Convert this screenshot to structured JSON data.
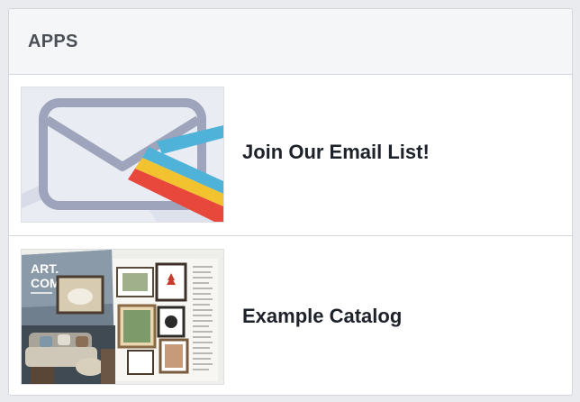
{
  "panel": {
    "title": "APPS"
  },
  "apps": [
    {
      "label": "Join Our Email List!",
      "icon": "envelope-icon"
    },
    {
      "label": "Example Catalog",
      "icon": "catalog-image"
    }
  ],
  "catalog_thumbnail": {
    "brand_line1": "ART.",
    "brand_line2": "COM"
  },
  "colors": {
    "page_background": "#e9ebee",
    "header_background": "#f5f6f7",
    "border": "#d3d6db",
    "envelope_stroke": "#9ea4bb",
    "stripe_blue": "#4fb3d9",
    "stripe_yellow": "#f3c32f",
    "stripe_red": "#e8473b"
  }
}
